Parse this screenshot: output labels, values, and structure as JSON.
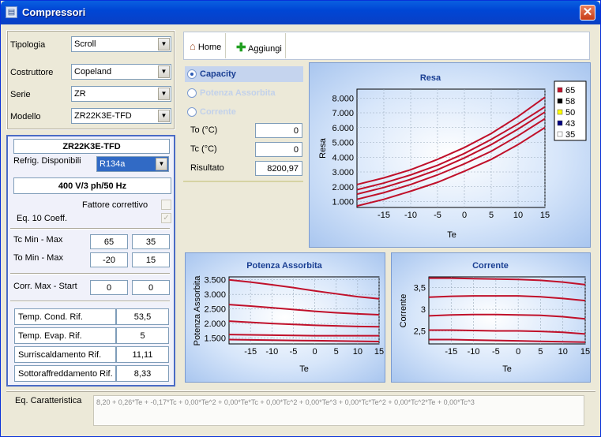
{
  "window": {
    "title": "Compressori",
    "close_label": "✕"
  },
  "filters": {
    "tipologia": {
      "label": "Tipologia",
      "value": "Scroll"
    },
    "costruttore": {
      "label": "Costruttore",
      "value": "Copeland"
    },
    "serie": {
      "label": "Serie",
      "value": "ZR"
    },
    "modello": {
      "label": "Modello",
      "value": "ZR22K3E-TFD"
    }
  },
  "info": {
    "model_name": "ZR22K3E-TFD",
    "refrig_label": "Refrig. Disponibili",
    "refrig_value": "R134a",
    "supply": "400 V/3 ph/50 Hz",
    "fattore_label": "Fattore correttivo",
    "fattore_checked": false,
    "eq10_label": "Eq. 10 Coeff.",
    "eq10_checked": true,
    "tc_label": "Tc Min - Max",
    "tc_min": "65",
    "tc_max": "35",
    "to_label": "To Min - Max",
    "to_min": "-20",
    "to_max": "15",
    "corr_label": "Corr. Max - Start",
    "corr_max": "0",
    "corr_start": "0",
    "rif": [
      {
        "label": "Temp. Cond. Rif.",
        "value": "53,5"
      },
      {
        "label": "Temp. Evap. Rif.",
        "value": "5"
      },
      {
        "label": "Surriscaldamento Rif.",
        "value": "11,11"
      },
      {
        "label": "Sottoraffreddamento Rif.",
        "value": "8,33"
      }
    ]
  },
  "toolbar": {
    "home_label": "Home",
    "add_label": "Aggiungi"
  },
  "calc": {
    "options": [
      {
        "label": "Capacity",
        "selected": true
      },
      {
        "label": "Potenza Assorbita",
        "selected": false
      },
      {
        "label": "Corrente",
        "selected": false
      }
    ],
    "to_label": "To (°C)",
    "to_value": "0",
    "tc_label": "Tc (°C)",
    "tc_value": "0",
    "result_label": "Risultato",
    "result_value": "8200,97"
  },
  "equation": {
    "label": "Eq. Caratteristica",
    "value": "8,20 + 0,26*Te + -0,17*Tc + 0,00*Te^2 + 0,00*Te*Tc + 0,00*Tc^2 + 0,00*Te^3 + 0,00*Tc*Te^2 + 0,00*Tc^2*Te + 0,00*Tc^3"
  },
  "colors": {
    "series_line": "#c0102a",
    "title_text": "#1a3f93",
    "legend_swatches": [
      "#c0102a",
      "#000000",
      "#ffff00",
      "#000080",
      "#ffffff"
    ]
  },
  "chart_data": [
    {
      "type": "line",
      "title": "Resa",
      "xlabel": "Te",
      "ylabel": "Resa",
      "xticks": [
        "-15",
        "-10",
        "-5",
        "0",
        "5",
        "10",
        "15"
      ],
      "yticks": [
        "1.000",
        "2.000",
        "3.000",
        "4.000",
        "5.000",
        "6.000",
        "7.000",
        "8.000"
      ],
      "xlim": [
        -20,
        15
      ],
      "ylim": [
        600,
        8600
      ],
      "legend_position": "right",
      "x": [
        -20,
        -15,
        -10,
        -5,
        0,
        5,
        10,
        15
      ],
      "series": [
        {
          "name": "65",
          "values": [
            700,
            1150,
            1700,
            2300,
            3050,
            3850,
            4850,
            6000
          ]
        },
        {
          "name": "58",
          "values": [
            1150,
            1600,
            2150,
            2800,
            3550,
            4400,
            5450,
            6600
          ]
        },
        {
          "name": "50",
          "values": [
            1500,
            1950,
            2500,
            3150,
            3950,
            4850,
            5900,
            7050
          ]
        },
        {
          "name": "43",
          "values": [
            1800,
            2250,
            2800,
            3450,
            4250,
            5200,
            6250,
            7400
          ]
        },
        {
          "name": "35",
          "values": [
            2150,
            2600,
            3150,
            3850,
            4650,
            5600,
            6750,
            8050
          ]
        }
      ]
    },
    {
      "type": "line",
      "title": "Potenza Assorbita",
      "xlabel": "Te",
      "ylabel": "Potenza Assorbita",
      "xticks": [
        "-15",
        "-10",
        "-5",
        "0",
        "5",
        "10",
        "15"
      ],
      "yticks": [
        "1.500",
        "2.000",
        "2.500",
        "3.000",
        "3.500"
      ],
      "xlim": [
        -20,
        15
      ],
      "ylim": [
        1300,
        3600
      ],
      "x": [
        -20,
        -15,
        -10,
        -5,
        0,
        5,
        10,
        15
      ],
      "series": [
        {
          "values": [
            3500,
            3420,
            3330,
            3230,
            3120,
            3020,
            2920,
            2850
          ]
        },
        {
          "values": [
            2650,
            2600,
            2540,
            2480,
            2420,
            2370,
            2330,
            2300
          ]
        },
        {
          "values": [
            2080,
            2040,
            2000,
            1970,
            1940,
            1920,
            1900,
            1890
          ]
        },
        {
          "values": [
            1620,
            1610,
            1600,
            1590,
            1580,
            1580,
            1580,
            1580
          ]
        },
        {
          "values": [
            1450,
            1440,
            1430,
            1420,
            1410,
            1400,
            1390,
            1380
          ]
        }
      ]
    },
    {
      "type": "line",
      "title": "Corrente",
      "xlabel": "Te",
      "ylabel": "Corrente",
      "xticks": [
        "-15",
        "-10",
        "-5",
        "0",
        "5",
        "10",
        "15"
      ],
      "yticks": [
        "2,5",
        "3",
        "3,5"
      ],
      "xlim": [
        -20,
        15
      ],
      "ylim": [
        2.2,
        3.75
      ],
      "x": [
        -20,
        -15,
        -10,
        -5,
        0,
        5,
        10,
        15
      ],
      "series": [
        {
          "values": [
            3.72,
            3.72,
            3.71,
            3.7,
            3.69,
            3.67,
            3.63,
            3.57
          ]
        },
        {
          "values": [
            3.28,
            3.3,
            3.31,
            3.31,
            3.31,
            3.29,
            3.25,
            3.2
          ]
        },
        {
          "values": [
            2.85,
            2.87,
            2.88,
            2.88,
            2.87,
            2.86,
            2.83,
            2.78
          ]
        },
        {
          "values": [
            2.52,
            2.52,
            2.51,
            2.5,
            2.5,
            2.49,
            2.47,
            2.43
          ]
        },
        {
          "values": [
            2.3,
            2.3,
            2.29,
            2.28,
            2.27,
            2.26,
            2.25,
            2.24
          ]
        }
      ]
    }
  ]
}
